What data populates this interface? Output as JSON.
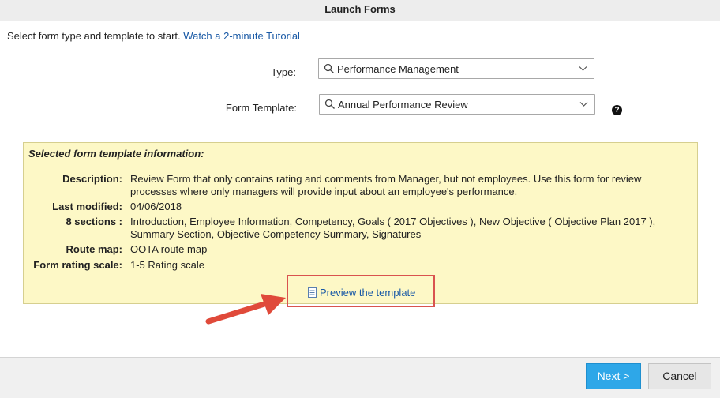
{
  "window": {
    "title": "Launch Forms"
  },
  "intro": {
    "text": "Select form type and template to start.",
    "tutorial_link": "Watch a 2-minute Tutorial"
  },
  "type_field": {
    "label": "Type:",
    "value": "Performance Management"
  },
  "template_field": {
    "label": "Form Template:",
    "value": "Annual Performance Review"
  },
  "help_icon": "?",
  "info": {
    "heading": "Selected form template information:",
    "rows": [
      {
        "key": "Description:",
        "value": "Review Form that only contains rating and comments from Manager, but not employees. Use this form for review processes where only managers will provide input about an employee's performance."
      },
      {
        "key": "Last modified:",
        "value": "04/06/2018"
      },
      {
        "key": "8 sections :",
        "value": "Introduction, Employee Information, Competency, Goals ( 2017 Objectives ), New Objective ( Objective Plan 2017 ), Summary Section, Objective Competency Summary, Signatures"
      },
      {
        "key": "Route map:",
        "value": "OOTA route map"
      },
      {
        "key": "Form rating scale:",
        "value": "1-5 Rating scale"
      }
    ],
    "preview_link": "Preview the template"
  },
  "footer": {
    "next_label": "Next >",
    "cancel_label": "Cancel"
  },
  "colors": {
    "accent": "#2ea7e8",
    "highlight_box": "#d9534f",
    "info_bg": "#fdf8c6",
    "link": "#1a5aa6"
  }
}
